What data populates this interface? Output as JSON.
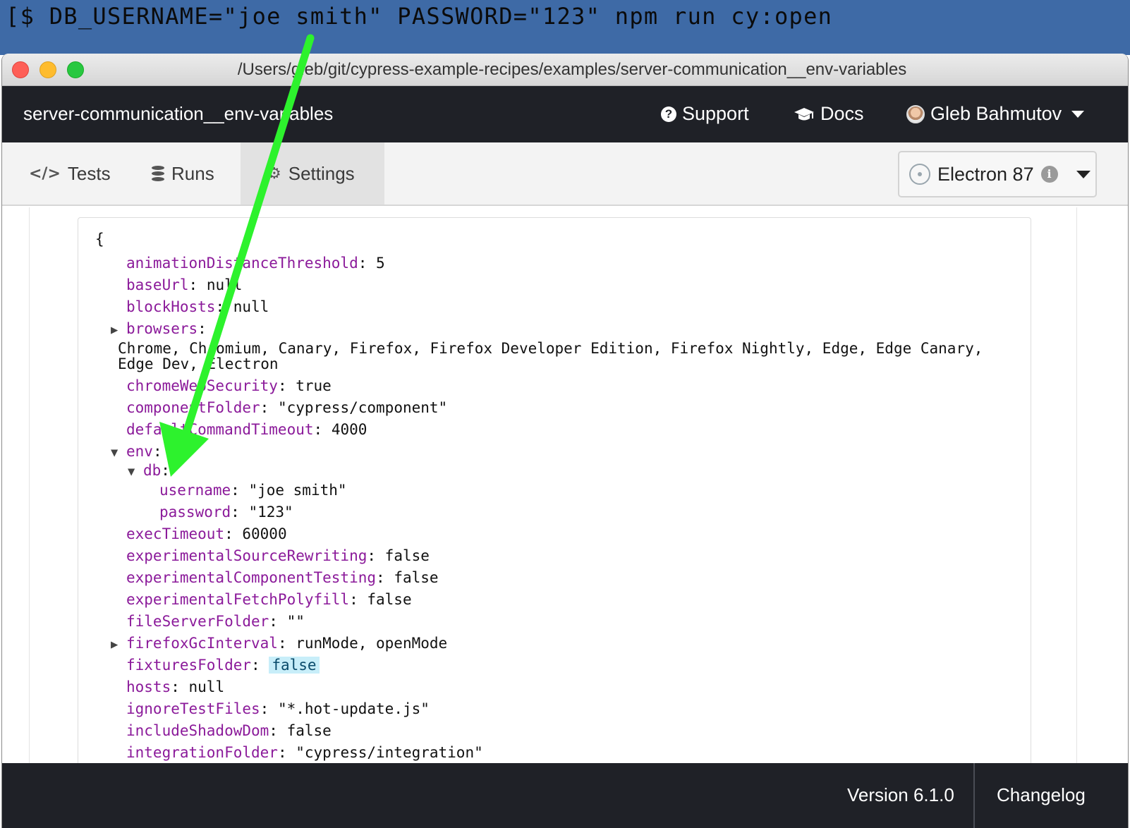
{
  "terminal": {
    "command": "[$ DB_USERNAME=\"joe smith\" PASSWORD=\"123\" npm run cy:open"
  },
  "window": {
    "title": "/Users/gleb/git/cypress-example-recipes/examples/server-communication__env-variables"
  },
  "navbar": {
    "project_name": "server-communication__env-variables",
    "support_label": "Support",
    "docs_label": "Docs",
    "user_name": "Gleb Bahmutov"
  },
  "tabs": [
    {
      "label": "Tests",
      "icon": "code-icon"
    },
    {
      "label": "Runs",
      "icon": "database-icon"
    },
    {
      "label": "Settings",
      "icon": "gear-icon",
      "active": true
    }
  ],
  "browser": {
    "selected": "Electron 87"
  },
  "config": {
    "open_brace": "{",
    "rows": [
      {
        "key": "animationDistanceThreshold",
        "value": "5"
      },
      {
        "key": "baseUrl",
        "value": "null"
      },
      {
        "key": "blockHosts",
        "value": "null"
      },
      {
        "key": "browsers",
        "value": "",
        "toggle": "collapsed"
      },
      {
        "key": "",
        "value": "Chrome, Chromium, Canary, Firefox, Firefox Developer Edition, Firefox Nightly, Edge, Edge Canary,"
      },
      {
        "key": "",
        "value": "Edge Dev, Electron"
      },
      {
        "key": "chromeWebSecurity",
        "value": "true"
      },
      {
        "key": "componentFolder",
        "value": "\"cypress/component\""
      },
      {
        "key": "defaultCommandTimeout",
        "value": "4000"
      },
      {
        "key": "env",
        "value": "",
        "toggle": "expanded"
      },
      {
        "key": "db",
        "value": "",
        "toggle": "expanded"
      },
      {
        "key": "username",
        "value": "\"joe smith\""
      },
      {
        "key": "password",
        "value": "\"123\""
      },
      {
        "key": "execTimeout",
        "value": "60000"
      },
      {
        "key": "experimentalSourceRewriting",
        "value": "false"
      },
      {
        "key": "experimentalComponentTesting",
        "value": "false"
      },
      {
        "key": "experimentalFetchPolyfill",
        "value": "false"
      },
      {
        "key": "fileServerFolder",
        "value": "\"\""
      },
      {
        "key": "firefoxGcInterval",
        "value": "runMode, openMode",
        "toggle": "collapsed"
      },
      {
        "key": "fixturesFolder",
        "value": "false",
        "highlight": true
      },
      {
        "key": "hosts",
        "value": "null"
      },
      {
        "key": "ignoreTestFiles",
        "value": "\"*.hot-update.js\""
      },
      {
        "key": "includeShadowDom",
        "value": "false"
      },
      {
        "key": "integrationFolder",
        "value": "\"cypress/integration\""
      }
    ]
  },
  "footer": {
    "version": "Version 6.1.0",
    "changelog": "Changelog"
  },
  "colors": {
    "terminal_bg": "#3e6aa6",
    "nav_bg": "#1f2127",
    "key_color": "#8b1a9a",
    "arrow": "#2df22d"
  }
}
